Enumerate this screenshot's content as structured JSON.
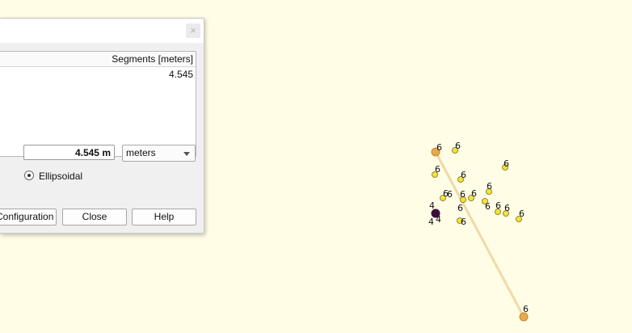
{
  "dialog": {
    "close_glyph": "×",
    "table": {
      "column_header": "Segments [meters]",
      "rows": [
        "4.545"
      ]
    },
    "total": "4.545 m",
    "unit": "meters",
    "ellipsoidal_label": "Ellipsoidal",
    "ellipsoidal_selected": true,
    "buttons": {
      "configuration": "Configuration",
      "close": "Close",
      "help": "Help"
    }
  },
  "map": {
    "colors": {
      "background": "#fffde6",
      "point_fill": "#f2e23a",
      "point_stroke": "#7a6a10",
      "cluster": "#3a0f3a",
      "measure_line": "#f0d9a8",
      "measure_endpoint": "#e8a850"
    },
    "point_labels": [
      "6",
      "6",
      "6",
      "6",
      "6",
      "6",
      "6",
      "6",
      "6",
      "6",
      "6",
      "6",
      "6",
      "6",
      "6",
      "6"
    ],
    "cluster_labels": [
      "4",
      "4",
      "4"
    ],
    "endpoint_label": "6"
  }
}
